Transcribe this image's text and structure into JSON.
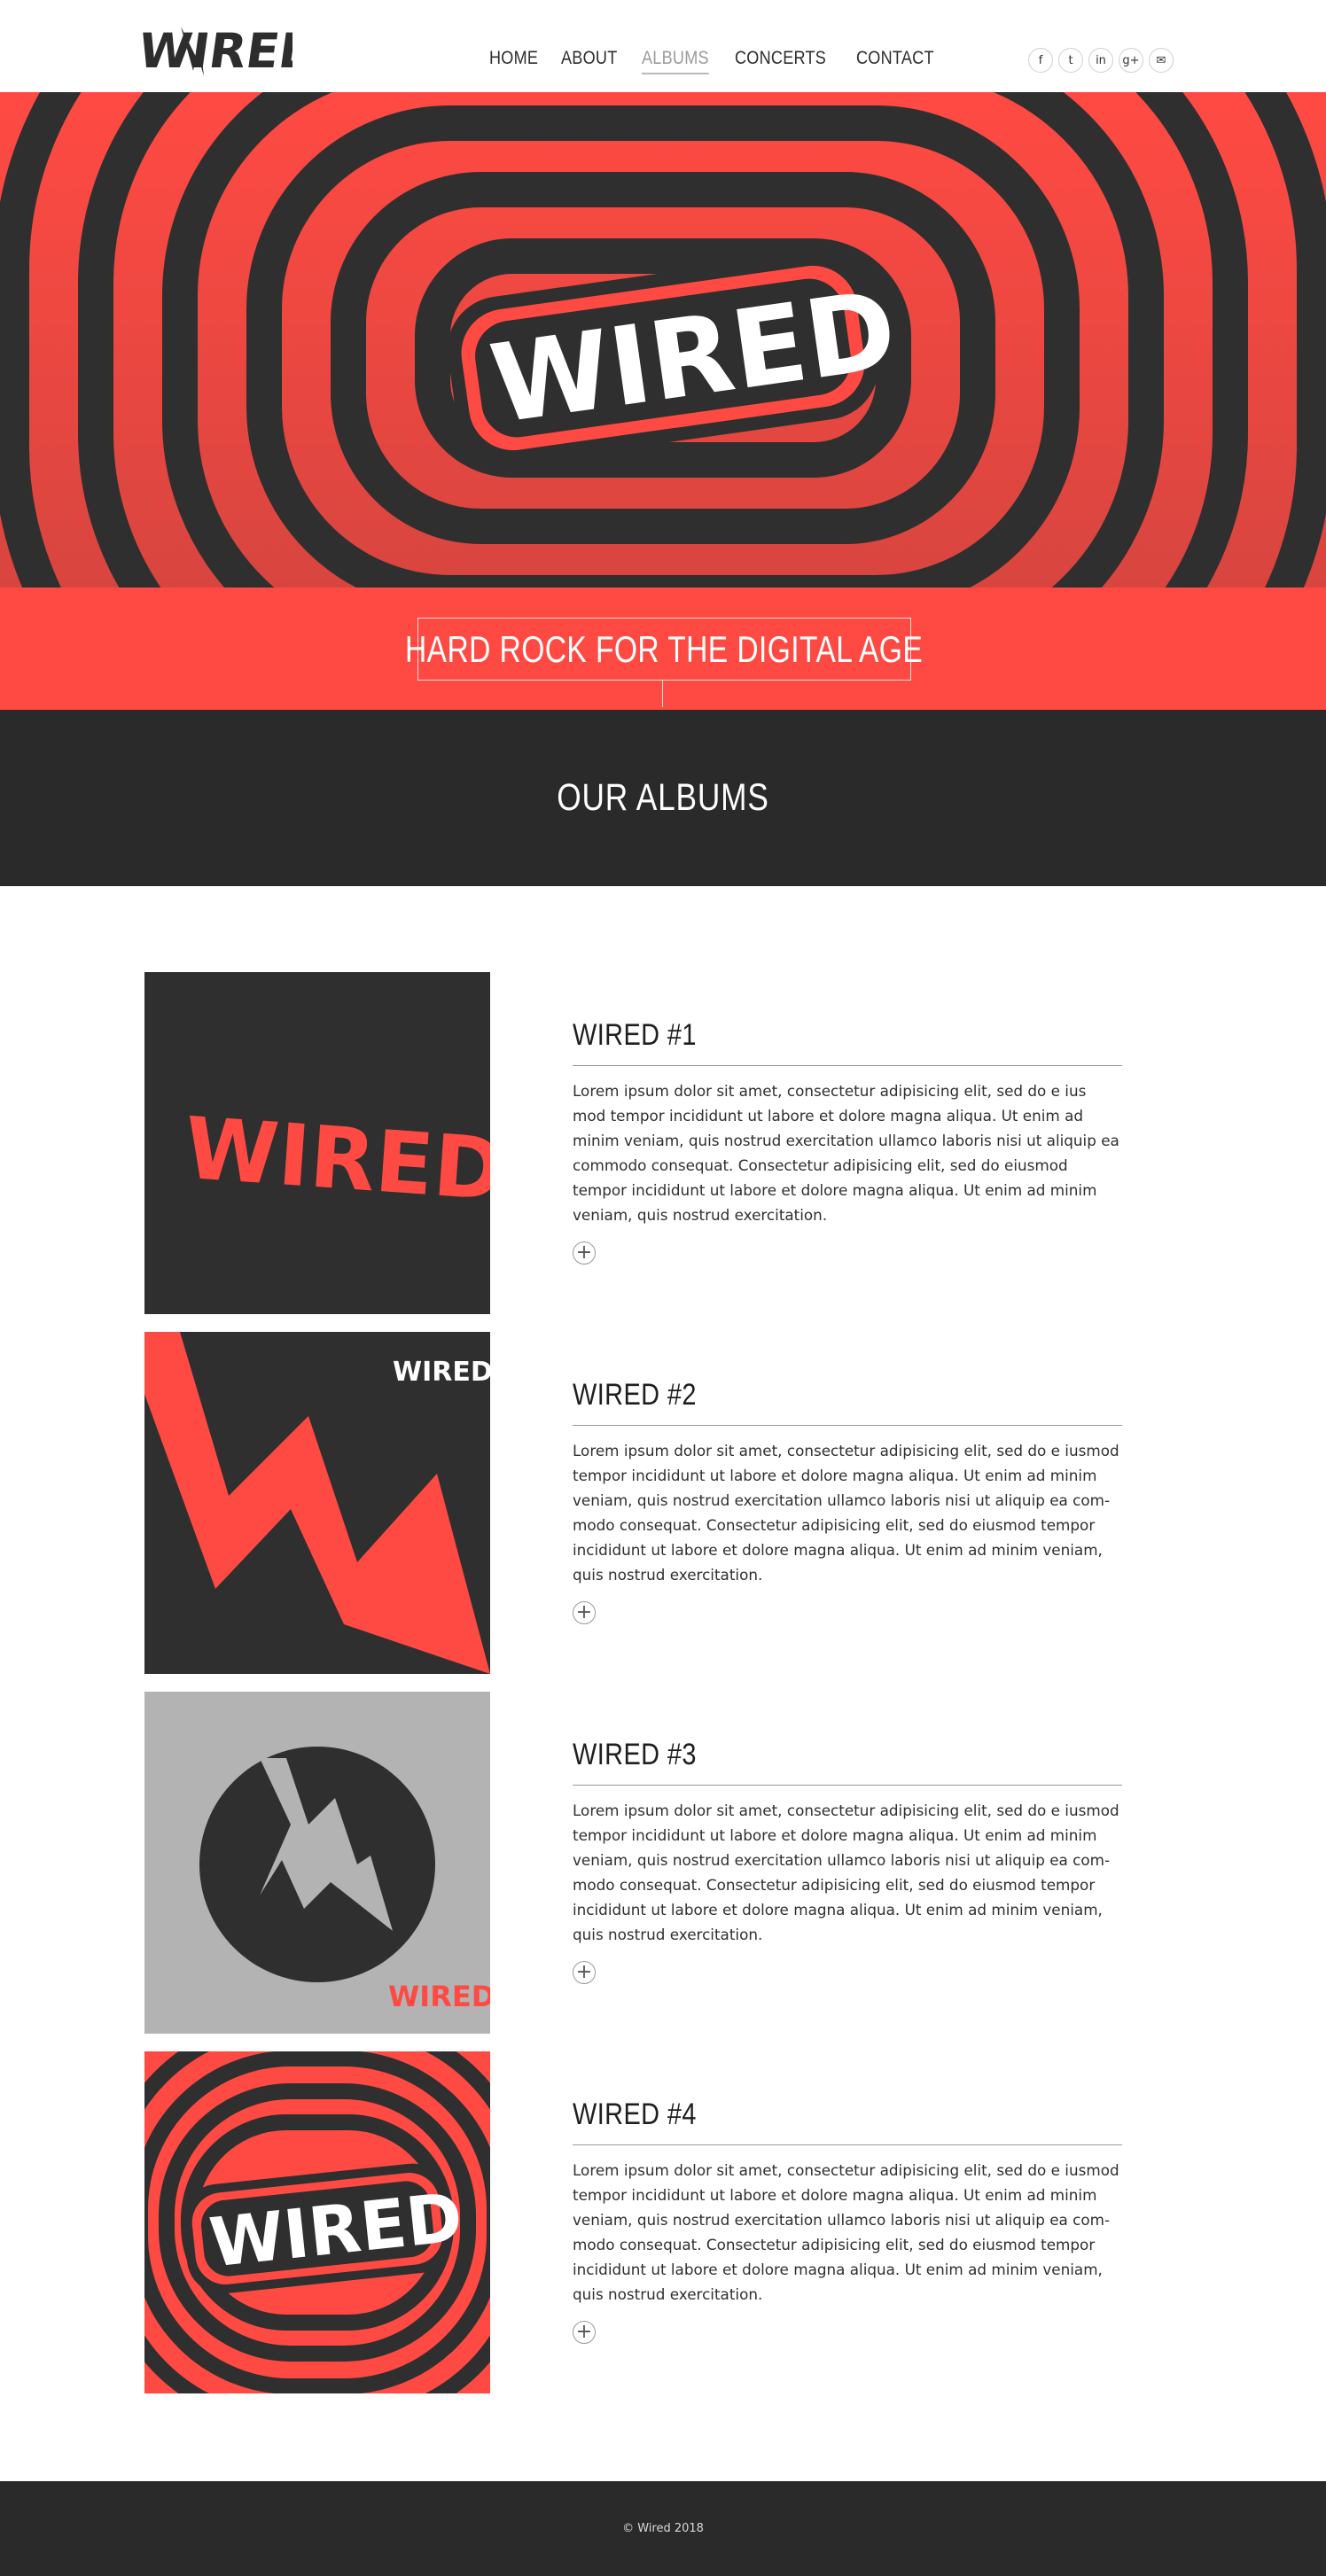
{
  "brand": {
    "logo_text": "WIRED"
  },
  "nav": {
    "items": [
      {
        "label": "HOME"
      },
      {
        "label": "ABOUT"
      },
      {
        "label": "ALBUMS"
      },
      {
        "label": "CONCERTS"
      },
      {
        "label": "CONTACT"
      }
    ],
    "active": "ALBUMS"
  },
  "social": {
    "icons": [
      "facebook-icon",
      "twitter-icon",
      "linkedin-icon",
      "google-plus-icon",
      "email-icon"
    ],
    "glyphs": [
      "f",
      "t",
      "in",
      "g+",
      "✉"
    ]
  },
  "hero": {
    "logo_text": "WIRED"
  },
  "tagline": {
    "text": "HARD ROCK FOR THE DIGITAL AGE"
  },
  "section": {
    "title": "OUR ALBUMS"
  },
  "albums": [
    {
      "title": "WIRED #1",
      "text": "Lorem ipsum dolor sit amet, consectetur adipisicing elit, sed do e ius mod tempor incididunt ut labore et dolore magna aliqua. Ut enim ad minim veniam, quis nostrud exercitation ullamco laboris nisi ut aliquip ea commodo consequat. Consectetur adipisicing elit, sed do eiusmod tempor incididunt ut labore et dolore magna aliqua. Ut enim ad minim veniam, quis nostrud exercitation.",
      "more": "+"
    },
    {
      "title": "WIRED #2",
      "text": "Lorem ipsum dolor sit amet, consectetur adipisicing elit, sed do e iusmod tempor incididunt ut labore et dolore magna aliqua. Ut enim ad minim veniam, quis nostrud exercitation ullamco laboris nisi ut aliquip ea com-modo consequat. Consectetur adipisicing elit, sed do eiusmod tempor incididunt ut labore et dolore magna aliqua. Ut enim ad minim veniam, quis nostrud exercitation.",
      "more": "+"
    },
    {
      "title": "WIRED #3",
      "text": "Lorem ipsum dolor sit amet, consectetur adipisicing elit, sed do e iusmod tempor incididunt ut labore et dolore magna aliqua. Ut enim ad minim veniam, quis nostrud exercitation ullamco laboris nisi ut aliquip ea com-modo consequat. Consectetur adipisicing elit, sed do eiusmod tempor incididunt ut labore et dolore magna aliqua. Ut enim ad minim veniam, quis nostrud exercitation.",
      "more": "+"
    },
    {
      "title": "WIRED #4",
      "text": "Lorem ipsum dolor sit amet, consectetur adipisicing elit, sed do e iusmod tempor incididunt ut labore et dolore magna aliqua. Ut enim ad minim veniam, quis nostrud exercitation ullamco laboris nisi ut aliquip ea com-modo consequat. Consectetur adipisicing elit, sed do eiusmod tempor incididunt ut labore et dolore magna aliqua. Ut enim ad minim veniam, quis nostrud exercitation.",
      "more": "+"
    }
  ],
  "footer": {
    "copyright": "© Wired 2018"
  },
  "colors": {
    "accent": "#ff4a43",
    "dark": "#2d2d2d",
    "grey": "#b3b3b3"
  }
}
